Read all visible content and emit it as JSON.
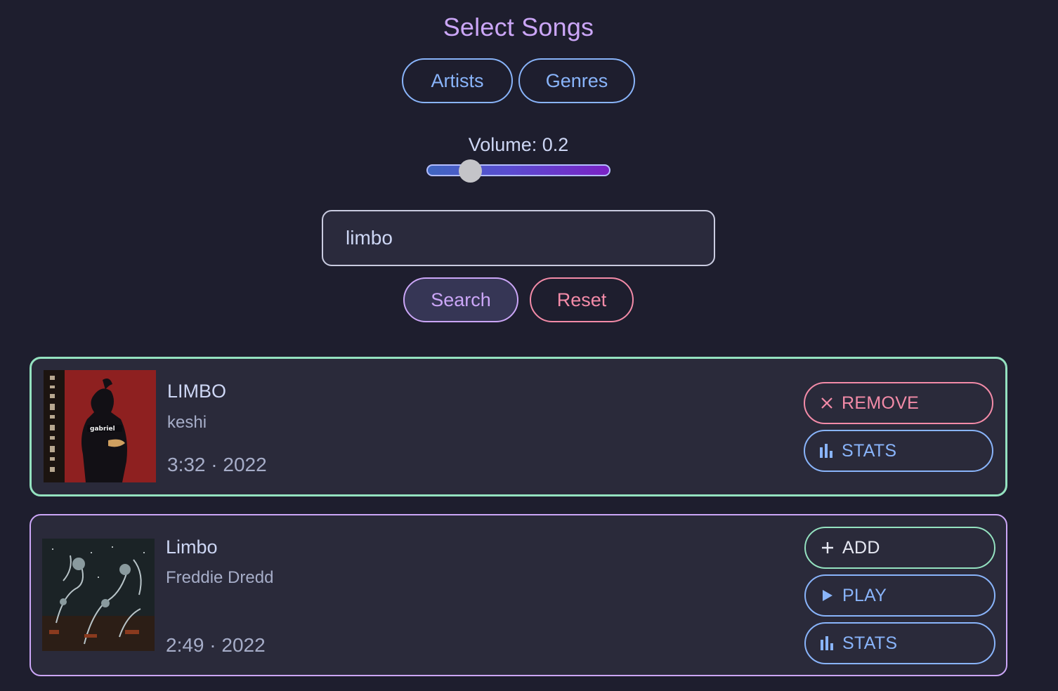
{
  "header": {
    "title": "Select Songs"
  },
  "filters": {
    "artists_label": "Artists",
    "genres_label": "Genres"
  },
  "volume": {
    "label": "Volume: 0.2",
    "value": 0.2,
    "gradient_start": "#3f66c0",
    "gradient_end": "#7a22c4"
  },
  "search": {
    "value": "limbo",
    "search_label": "Search",
    "reset_label": "Reset"
  },
  "results": [
    {
      "title": "LIMBO",
      "artist": "keshi",
      "meta": "3:32 · 2022",
      "art_text": "gabriel",
      "selected": true,
      "actions": {
        "remove_label": "REMOVE",
        "stats_label": "STATS"
      }
    },
    {
      "title": "Limbo",
      "artist": "Freddie Dredd",
      "meta": "2:49 · 2022",
      "selected": false,
      "actions": {
        "add_label": "ADD",
        "play_label": "PLAY",
        "stats_label": "STATS"
      }
    }
  ],
  "colors": {
    "background": "#1e1e2e",
    "accent_purple": "#cba6f7",
    "accent_blue": "#89b4fa",
    "accent_red": "#f38ba8",
    "accent_green": "#94e2c0"
  },
  "icons": {
    "remove": "close-icon",
    "stats": "bar-chart-icon",
    "add": "plus-icon",
    "play": "play-icon"
  }
}
